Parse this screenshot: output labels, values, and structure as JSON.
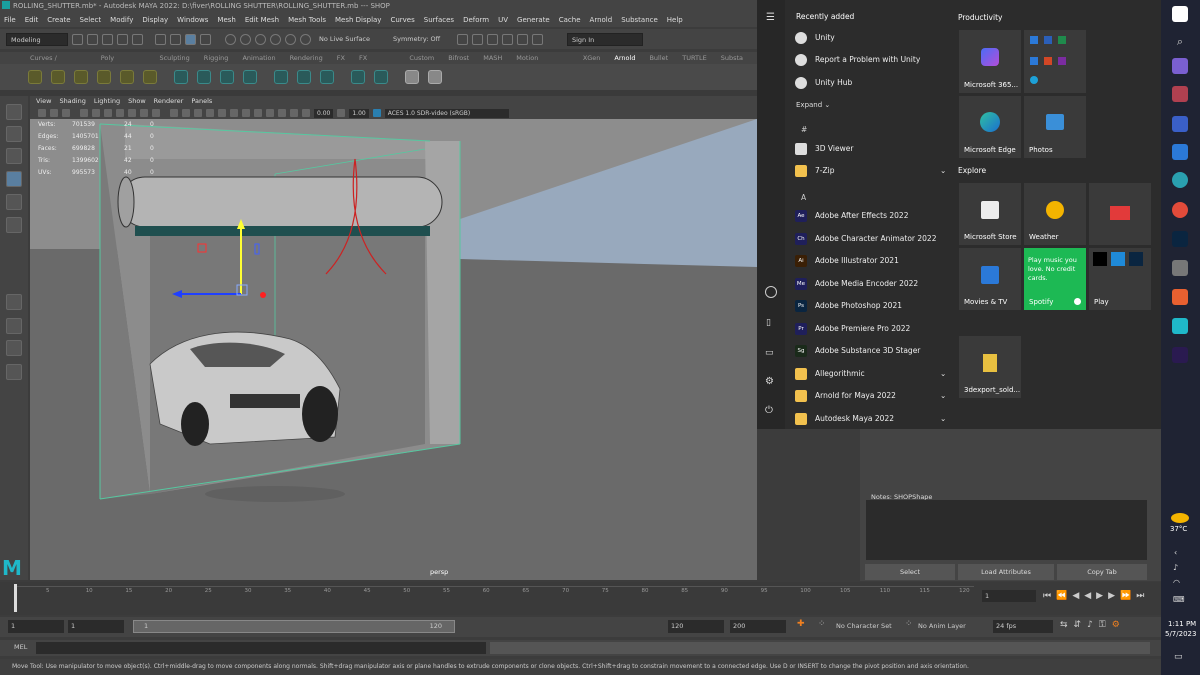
{
  "maya": {
    "title": "ROLLING_SHUTTER.mb* - Autodesk MAYA 2022: D:\\fiver\\ROLLING SHUTTER\\ROLLING_SHUTTER.mb  ---  SHOP",
    "menus": [
      "File",
      "Edit",
      "Create",
      "Select",
      "Modify",
      "Display",
      "Windows",
      "Mesh",
      "Edit Mesh",
      "Mesh Tools",
      "Mesh Display",
      "Curves",
      "Surfaces",
      "Deform",
      "UV",
      "Generate",
      "Cache",
      "Arnold",
      "Substance",
      "Help"
    ],
    "mode": "Modeling",
    "live_surface": "No Live Surface",
    "symmetry": "Symmetry: Off",
    "sign_in": "Sign In",
    "shelf_tabs": [
      "Curves / Surfaces",
      "Poly Modeling",
      "Sculpting",
      "Rigging",
      "Animation",
      "Rendering",
      "FX",
      "FX Caching",
      "Custom",
      "Bifrost",
      "MASH",
      "Motion Graphics",
      "XGen",
      "Arnold",
      "Bullet",
      "TURTLE",
      "Substa"
    ],
    "active_shelf": "Arnold",
    "viewport_menus": [
      "View",
      "Shading",
      "Lighting",
      "Show",
      "Renderer",
      "Panels"
    ],
    "exposure": "0.00",
    "gamma": "1.00",
    "colorspace": "ACES 1.0 SDR-video (sRGB)",
    "hud": [
      {
        "label": "Verts:",
        "a": "701539",
        "b": "24",
        "c": "0"
      },
      {
        "label": "Edges:",
        "a": "1405701",
        "b": "44",
        "c": "0"
      },
      {
        "label": "Faces:",
        "a": "699828",
        "b": "21",
        "c": "0"
      },
      {
        "label": "Tris:",
        "a": "1399602",
        "b": "42",
        "c": "0"
      },
      {
        "label": "UVs:",
        "a": "995573",
        "b": "40",
        "c": "0"
      }
    ],
    "camera": "persp",
    "timeline_ticks": [
      "5",
      "10",
      "15",
      "20",
      "25",
      "30",
      "35",
      "40",
      "45",
      "50",
      "55",
      "60",
      "65",
      "70",
      "75",
      "80",
      "85",
      "90",
      "95",
      "100",
      "105",
      "110",
      "115",
      "120"
    ],
    "current_frame": "1",
    "range_start": "1",
    "range_start2": "1",
    "range_inner_start": "1",
    "range_inner_end": "120",
    "range_end": "120",
    "range_end2": "200",
    "character_set": "No Character Set",
    "anim_layer": "No Anim Layer",
    "fps": "24 fps",
    "mel_label": "MEL",
    "help_text": "Move Tool: Use manipulator to move object(s). Ctrl+middle-drag to move components along normals. Shift+drag manipulator axis or plane handles to extrude components or clone objects. Ctrl+Shift+drag to constrain movement to a connected edge. Use D or INSERT to change the pivot position and axis orientation.",
    "notes_label": "Notes:  SHOPShape",
    "attr_buttons": [
      "Select",
      "Load Attributes",
      "Copy Tab"
    ]
  },
  "start_menu": {
    "recently_added": "Recently added",
    "recent": [
      "Unity",
      "Report a Problem with Unity",
      "Unity Hub"
    ],
    "expand": "Expand",
    "hash": "#",
    "letter_a": "A",
    "apps": [
      {
        "name": "3D Viewer",
        "icon": "cube-icon",
        "color": "#dddddd"
      },
      {
        "name": "7-Zip",
        "icon": "folder-icon",
        "color": "#f2c14e",
        "expand": true
      },
      {
        "name": "Adobe After Effects 2022",
        "icon": "ae-icon",
        "badge": "Ae",
        "color": "#1f1f5a"
      },
      {
        "name": "Adobe Character Animator 2022",
        "icon": "ch-icon",
        "badge": "Ch",
        "color": "#1f1f5a"
      },
      {
        "name": "Adobe Illustrator 2021",
        "icon": "ai-icon",
        "badge": "Ai",
        "color": "#3a1f05"
      },
      {
        "name": "Adobe Media Encoder 2022",
        "icon": "me-icon",
        "badge": "Me",
        "color": "#1f1f5a"
      },
      {
        "name": "Adobe Photoshop 2021",
        "icon": "ps-icon",
        "badge": "Ps",
        "color": "#0a2540"
      },
      {
        "name": "Adobe Premiere Pro 2022",
        "icon": "pr-icon",
        "badge": "Pr",
        "color": "#1f1f5a"
      },
      {
        "name": "Adobe Substance 3D Stager",
        "icon": "sg-icon",
        "badge": "Sg",
        "color": "#1a2a1a"
      },
      {
        "name": "Allegorithmic",
        "icon": "folder-icon",
        "color": "#f2c14e",
        "expand": true
      },
      {
        "name": "Arnold for Maya 2022",
        "icon": "folder-icon",
        "color": "#f2c14e",
        "expand": true
      },
      {
        "name": "Autodesk Maya 2022",
        "icon": "folder-icon",
        "color": "#f2c14e",
        "expand": true
      }
    ],
    "productivity": "Productivity",
    "explore": "Explore",
    "tiles": {
      "m365": "Microsoft 365...",
      "edge": "Microsoft Edge",
      "photos": "Photos",
      "store": "Microsoft Store",
      "weather": "Weather",
      "movies": "Movies & TV",
      "spotify_text": "Play music you love. No credit cards.",
      "spotify": "Spotify",
      "play": "Play",
      "export": "3dexport_sold..."
    }
  },
  "taskbar": {
    "temperature": "37°C",
    "time": "1:11 PM",
    "date": "5/7/2023"
  }
}
